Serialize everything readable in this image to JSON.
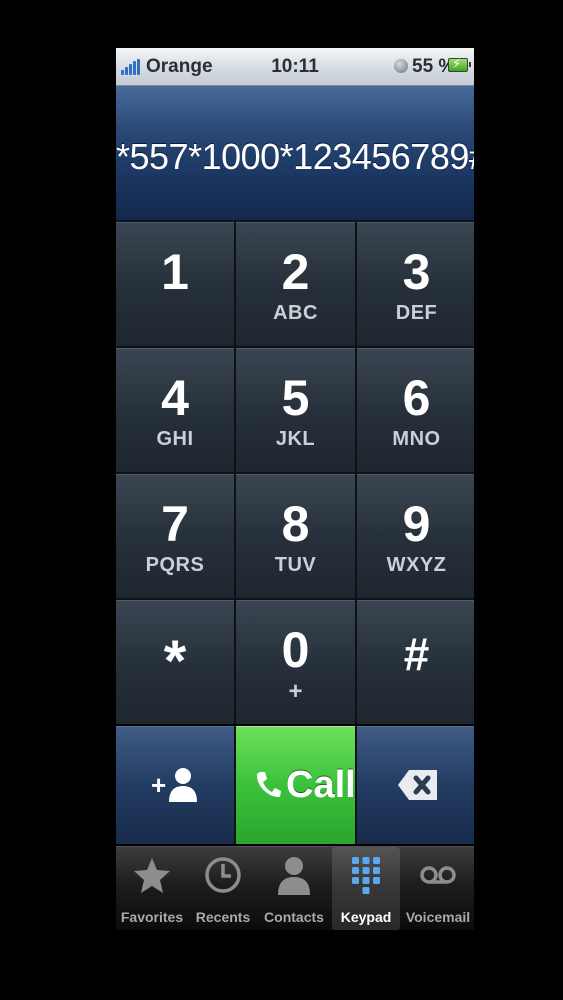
{
  "status_bar": {
    "carrier": "Orange",
    "time": "10:11",
    "battery_percent": "55 %",
    "icons": [
      "signal-icon",
      "orientation-lock-icon",
      "battery-charging-icon"
    ]
  },
  "display": {
    "number": "*557*1000*123456789#"
  },
  "keypad": {
    "keys": [
      {
        "digit": "1",
        "letters": ""
      },
      {
        "digit": "2",
        "letters": "ABC"
      },
      {
        "digit": "3",
        "letters": "DEF"
      },
      {
        "digit": "4",
        "letters": "GHI"
      },
      {
        "digit": "5",
        "letters": "JKL"
      },
      {
        "digit": "6",
        "letters": "MNO"
      },
      {
        "digit": "7",
        "letters": "PQRS"
      },
      {
        "digit": "8",
        "letters": "TUV"
      },
      {
        "digit": "9",
        "letters": "WXYZ"
      },
      {
        "digit": "*",
        "letters": ""
      },
      {
        "digit": "0",
        "letters": "+"
      },
      {
        "digit": "#",
        "letters": ""
      }
    ]
  },
  "actions": {
    "add_contact_icon": "add-contact-icon",
    "call_label": "Call",
    "delete_icon": "delete-icon",
    "call_color": "#3bc23c"
  },
  "tabbar": {
    "tabs": [
      {
        "label": "Favorites",
        "icon": "star-icon",
        "selected": false
      },
      {
        "label": "Recents",
        "icon": "clock-icon",
        "selected": false
      },
      {
        "label": "Contacts",
        "icon": "person-icon",
        "selected": false
      },
      {
        "label": "Keypad",
        "icon": "keypad-icon",
        "selected": true
      },
      {
        "label": "Voicemail",
        "icon": "voicemail-icon",
        "selected": false
      }
    ]
  }
}
